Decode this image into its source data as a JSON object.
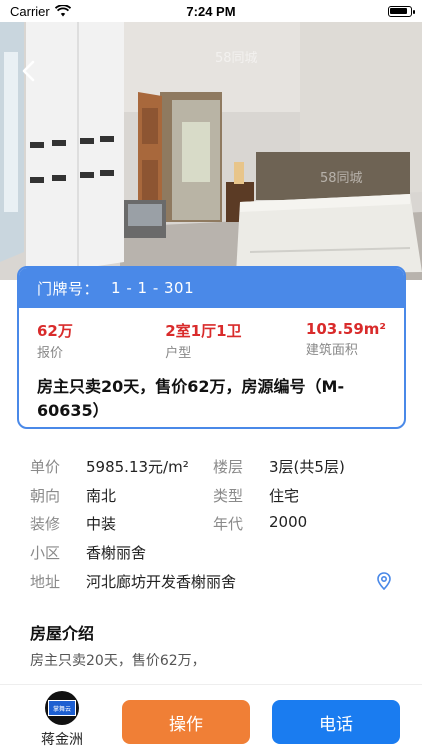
{
  "status_bar": {
    "carrier": "Carrier",
    "time": "7:24 PM"
  },
  "card": {
    "address_label": "门牌号：",
    "address_value": "1 - 1 - 301",
    "price": {
      "value": "62万",
      "label": "报价"
    },
    "layout": {
      "value": "2室1厅1卫",
      "label": "户型"
    },
    "area": {
      "value": "103.59m²",
      "label": "建筑面积"
    },
    "title": "房主只卖20天，售价62万，房源编号（M-60635）"
  },
  "details": {
    "unit_price": {
      "label": "单价",
      "value": "5985.13元/m²"
    },
    "floor": {
      "label": "楼层",
      "value": "3层(共5层)"
    },
    "orientation": {
      "label": "朝向",
      "value": "南北"
    },
    "type": {
      "label": "类型",
      "value": "住宅"
    },
    "decoration": {
      "label": "装修",
      "value": "中装"
    },
    "year": {
      "label": "年代",
      "value": "2000"
    },
    "community": {
      "label": "小区",
      "value": "香榭丽舍"
    },
    "location": {
      "label": "地址",
      "value": "河北廊坊开发香榭丽舍"
    }
  },
  "intro": {
    "title": "房屋介绍",
    "text": "房主只卖20天，售价62万，"
  },
  "bottom": {
    "agent_badge": "掌舞云",
    "agent_name": "蒋金洲",
    "operate_label": "操作",
    "call_label": "电话"
  },
  "colors": {
    "accent": "#4a89e8",
    "price_red": "#d92b2b",
    "operate": "#f07f36",
    "call": "#1a7cf0"
  },
  "icons": [
    "wifi-icon",
    "battery-icon",
    "back-arrow-icon",
    "location-pin-icon"
  ]
}
